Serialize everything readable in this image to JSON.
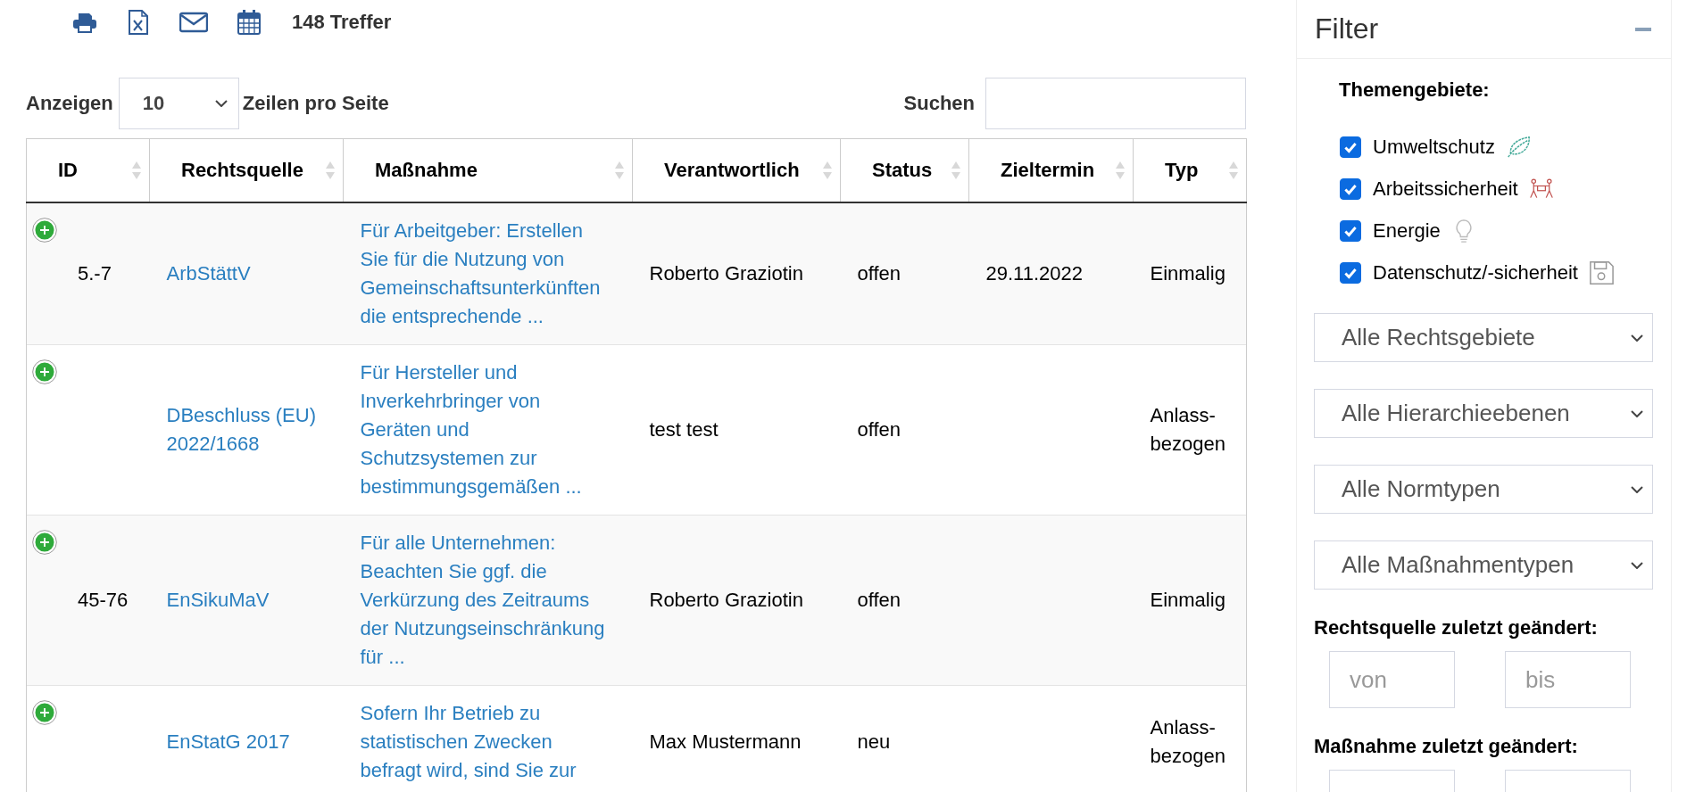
{
  "toolbar": {
    "result_count": "148 Treffer"
  },
  "page_length": {
    "label_before": "Anzeigen",
    "value": "10",
    "label_after": "Zeilen pro Seite"
  },
  "search": {
    "label": "Suchen"
  },
  "table": {
    "columns": [
      "ID",
      "Rechtsquelle",
      "Maßnahme",
      "Verantwortlich",
      "Status",
      "Zieltermin",
      "Typ"
    ],
    "rows": [
      {
        "id": "5.-7",
        "source": "ArbStättV",
        "measure": "Für Arbeitgeber: Erstellen Sie für die Nutzung von Gemeinschaftsunterkünften die entsprechende ...",
        "owner": "Roberto Graziotin",
        "status": "offen",
        "due": "29.11.2022",
        "type": "Einmalig"
      },
      {
        "source": "DBeschluss (EU) 2022/1668",
        "measure": "Für Hersteller und Inverkehrbringer von Geräten und Schutzsystemen zur bestimmungsgemäßen ...",
        "owner": "test test",
        "status": "offen",
        "type": "Anlass-bezogen"
      },
      {
        "id": "45-76",
        "source": "EnSikuMaV",
        "measure": "Für alle Unternehmen: Beachten Sie ggf. die Verkürzung des Zeitraums der Nutzungseinschränkung für ...",
        "owner": "Roberto Graziotin",
        "status": "offen",
        "type": "Einmalig"
      },
      {
        "source": "EnStatG 2017",
        "measure": "Sofern Ihr Betrieb zu statistischen Zwecken befragt wird, sind Sie zur",
        "owner": "Max Mustermann",
        "status": "neu",
        "type": "Anlass-bezogen"
      }
    ]
  },
  "filter": {
    "title": "Filter",
    "topics_label": "Themengebiete:",
    "topics": [
      {
        "label": "Umweltschutz",
        "checked": true,
        "kind": "leaf"
      },
      {
        "label": "Arbeitssicherheit",
        "checked": true,
        "kind": "people"
      },
      {
        "label": "Energie",
        "checked": true,
        "kind": "bulb"
      },
      {
        "label": "Datenschutz/-sicherheit",
        "checked": true,
        "kind": "floppy"
      }
    ],
    "selects": [
      "Alle Rechtsgebiete",
      "Alle Hierarchieebenen",
      "Alle Normtypen",
      "Alle Maßnahmentypen"
    ],
    "date_filters": [
      {
        "label": "Rechtsquelle zuletzt geändert:",
        "from_placeholder": "von",
        "to_placeholder": "bis"
      },
      {
        "label": "Maßnahme zuletzt geändert:"
      }
    ]
  }
}
